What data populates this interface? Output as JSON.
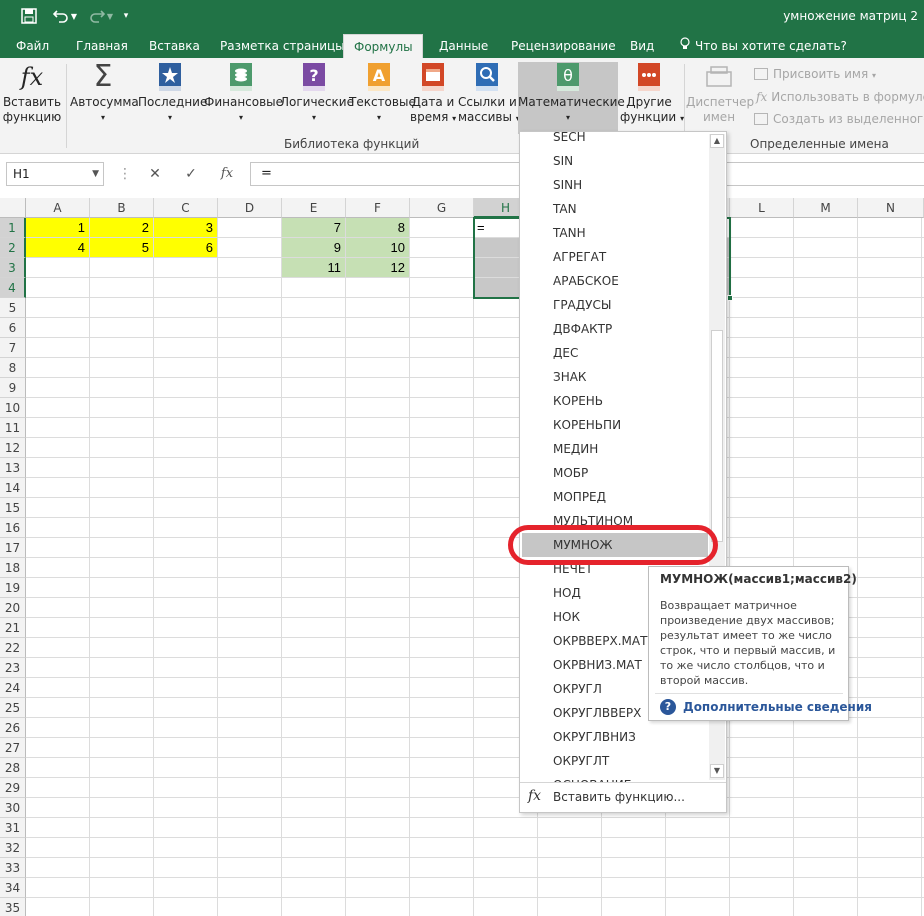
{
  "titlebar": {
    "title": "умножение матриц 2"
  },
  "tabs": [
    {
      "label": "Файл"
    },
    {
      "label": "Главная"
    },
    {
      "label": "Вставка"
    },
    {
      "label": "Разметка страницы"
    },
    {
      "label": "Формулы"
    },
    {
      "label": "Данные"
    },
    {
      "label": "Рецензирование"
    },
    {
      "label": "Вид"
    }
  ],
  "tellme": "Что вы хотите сделать?",
  "ribbon": {
    "insert_function": {
      "line1": "Вставить",
      "line2": "функцию"
    },
    "autosum": "Автосумма",
    "recent": "Последние",
    "financial": "Финансовые",
    "logical": "Логические",
    "text": "Текстовые",
    "datetime": {
      "line1": "Дата и",
      "line2": "время"
    },
    "lookup": {
      "line1": "Ссылки и",
      "line2": "массивы"
    },
    "math": "Математические",
    "other": {
      "line1": "Другие",
      "line2": "функции"
    },
    "name_manager": {
      "line1": "Диспетчер",
      "line2": "имен"
    },
    "define_name": "Присвоить имя",
    "use_in_formula": "Использовать в формуле",
    "create_from_selection": "Создать из выделенного",
    "group_library": "Библиотека функций",
    "group_names": "Определенные имена"
  },
  "formula_bar": {
    "name_box": "H1",
    "formula": "="
  },
  "columns": [
    "A",
    "B",
    "C",
    "D",
    "E",
    "F",
    "G",
    "H",
    "I",
    "J",
    "K",
    "L",
    "M",
    "N"
  ],
  "rows": [
    "1",
    "2",
    "3",
    "4",
    "5",
    "6",
    "7",
    "8",
    "9",
    "10",
    "11",
    "12",
    "13",
    "14",
    "15",
    "16",
    "17",
    "18",
    "19",
    "20",
    "21",
    "22",
    "23",
    "24",
    "25",
    "26",
    "27",
    "28",
    "29",
    "30",
    "31",
    "32",
    "33",
    "34",
    "35"
  ],
  "cells": {
    "A1": "1",
    "B1": "2",
    "C1": "3",
    "A2": "4",
    "B2": "5",
    "C2": "6",
    "E1": "7",
    "F1": "8",
    "E2": "9",
    "F2": "10",
    "E3": "11",
    "F3": "12",
    "H1": "="
  },
  "colors": {
    "accent": "#217346",
    "yellow_fill": "#ffff00",
    "green_fill": "#c6e0b4",
    "selection_gray": "#c8c8c8",
    "highlight_red": "#e5232c"
  },
  "dropdown": {
    "items": [
      "SECH",
      "SIN",
      "SINH",
      "TAN",
      "TANH",
      "АГРЕГАТ",
      "АРАБСКОЕ",
      "ГРАДУСЫ",
      "ДВФАКТР",
      "ДЕС",
      "ЗНАК",
      "КОРЕНЬ",
      "КОРЕНЬПИ",
      "МЕДИН",
      "МОБР",
      "МОПРЕД",
      "МУЛЬТИНОМ",
      "МУМНОЖ",
      "НЕЧЕТ",
      "НОД",
      "НОК",
      "ОКРВВЕРХ.МАТ",
      "ОКРВНИЗ.МАТ",
      "ОКРУГЛ",
      "ОКРУГЛВВЕРХ",
      "ОКРУГЛВНИЗ",
      "ОКРУГЛТ",
      "ОСНОВАНИЕ"
    ],
    "highlighted": "МУМНОЖ",
    "footer": "Вставить функцию..."
  },
  "tooltip": {
    "title": "МУМНОЖ(массив1;массив2)",
    "description": "Возвращает матричное произведение двух массивов; результат имеет то же число строк, что и первый массив, и то же число столбцов, что и второй массив.",
    "link": "Дополнительные сведения"
  }
}
